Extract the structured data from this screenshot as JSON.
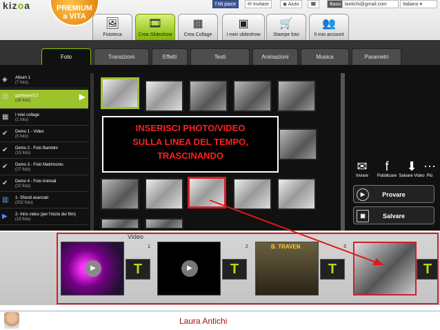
{
  "header": {
    "logo_prefix": "kiz",
    "logo_accent": "o",
    "logo_suffix": "a",
    "premium_line1": "PREMIUM",
    "premium_line2": "a VITA",
    "fb_label": "Mi piace",
    "invite_label": "Invitare",
    "help_label": "Aiuto",
    "user_label": "Basic",
    "email": "lantichi@gmail.com",
    "language": "Italiano"
  },
  "nav_tabs": [
    {
      "label": "Fototeca",
      "icon": "photo-icon"
    },
    {
      "label": "Crea Slideshow",
      "icon": "slideshow-icon",
      "active": true
    },
    {
      "label": "Crea Collage",
      "icon": "collage-icon"
    },
    {
      "label": "I miei slideshow",
      "icon": "film-icon"
    },
    {
      "label": "Stampe foto",
      "icon": "cart-icon"
    },
    {
      "label": "Il mio account",
      "icon": "users-icon"
    }
  ],
  "sub_tabs": [
    {
      "label": "Foto",
      "active": true
    },
    {
      "label": "Transizioni"
    },
    {
      "label": "Effetti"
    },
    {
      "label": "Testi"
    },
    {
      "label": "Animazioni"
    },
    {
      "label": "Musica"
    },
    {
      "label": "Parametri"
    }
  ],
  "albums": [
    {
      "name": "Album 1",
      "count": "(7 foto)"
    },
    {
      "name": "gambara012",
      "count": "(36 foto)",
      "selected": true
    },
    {
      "name": "I miei collage",
      "count": "(1 foto)"
    },
    {
      "name": "Demo 1 - Video",
      "count": "(5 foto)"
    },
    {
      "name": "Demo 2 - Foto Bambini",
      "count": "(15 foto)"
    },
    {
      "name": "Demo 3 - Foto Matrimonio",
      "count": "(27 foto)"
    },
    {
      "name": "Demo 4 - Foto Animali",
      "count": "(22 foto)"
    },
    {
      "name": "1- Sfondi avanzati",
      "count": "(202 foto)"
    },
    {
      "name": "2- Intro video (per l'inizio dei film)",
      "count": "(19 foto)"
    }
  ],
  "overlay": {
    "line1": "INSERISCI PHOTO/VIDEO",
    "line2": "SULLA LINEA DEL TEMPO,",
    "line3": "TRASCINANDO"
  },
  "actions": {
    "invite": "Inviare",
    "publish": "Pubblicare",
    "save_video": "Salvare Video",
    "more": "Più",
    "try_btn": "Provare",
    "save_btn": "Salvare"
  },
  "timeline": {
    "video_label": "Video",
    "slots": [
      "1",
      "2",
      "3"
    ],
    "slot3_caption": "B. TRAVEN",
    "text_glyph": "T"
  },
  "footer": {
    "author": "Laura Antichi"
  },
  "colors": {
    "accent": "#8bc300",
    "highlight_red": "#d21e2a"
  }
}
